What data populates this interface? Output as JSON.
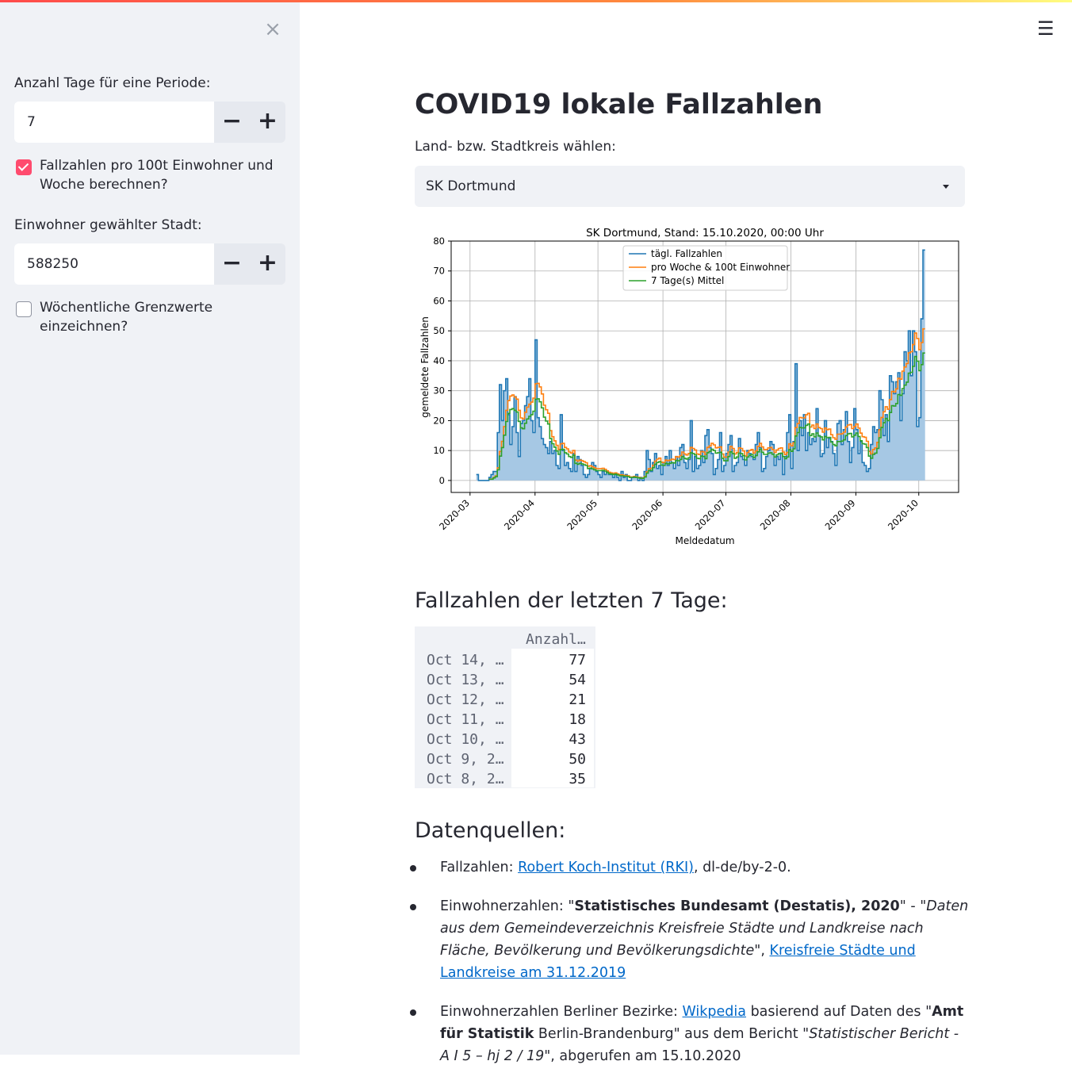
{
  "sidebar": {
    "period_label": "Anzahl Tage für eine Periode:",
    "period_value": "7",
    "minus": "−",
    "plus": "+",
    "per100k_label": "Fallzahlen pro 100t Einwohner und Woche berechnen?",
    "per100k_checked": true,
    "population_label": "Einwohner gewählter Stadt:",
    "population_value": "588250",
    "thresholds_label": "Wöchentliche Grenzwerte einzeichnen?",
    "thresholds_checked": false,
    "close_icon": "close-icon"
  },
  "header": {
    "menu_icon": "hamburger-menu-icon"
  },
  "main": {
    "title": "COVID19 lokale Fallzahlen",
    "select_label": "Land- bzw. Stadtkreis wählen:",
    "select_value": "SK Dortmund",
    "table_title": "Fallzahlen der letzten 7 Tage:",
    "table": {
      "column": "Anzahl…",
      "rows": [
        {
          "index": "Oct 14, …",
          "value": "77"
        },
        {
          "index": "Oct 13, …",
          "value": "54"
        },
        {
          "index": "Oct 12, …",
          "value": "21"
        },
        {
          "index": "Oct 11, …",
          "value": "18"
        },
        {
          "index": "Oct 10, …",
          "value": "43"
        },
        {
          "index": "Oct 9, 2…",
          "value": "50"
        },
        {
          "index": "Oct 8, 2…",
          "value": "35"
        }
      ]
    },
    "sources_title": "Datenquellen:",
    "sources": {
      "s1_prefix": "Fallzahlen: ",
      "s1_link": "Robert Koch-Institut (RKI)",
      "s1_suffix": ", dl-de/by-2-0.",
      "s2_prefix": "Einwohnerzahlen: \"",
      "s2_bold": "Statistisches Bundesamt (Destatis), 2020",
      "s2_mid": "\" - \"",
      "s2_italic": "Daten aus dem Gemeindeverzeichnis Kreisfreie Städte und Landkreise nach Fläche, Bevölkerung und Bevölkerungsdichte",
      "s2_after": "\", ",
      "s2_link": "Kreisfreie Städte und Landkreise am 31.12.2019",
      "s3_prefix": "Einwohnerzahlen Berliner Bezirke: ",
      "s3_link": "Wikpedia",
      "s3_mid": " basierend auf Daten des \"",
      "s3_bold1": "Amt für Statistik",
      "s3_mid2": " Berlin-Brandenburg\" aus dem Bericht \"",
      "s3_italic": "Statistischer Bericht - A I 5 – hj 2 / 19",
      "s3_suffix": "\", abgerufen am 15.10.2020"
    }
  },
  "chart_data": {
    "type": "line",
    "title": "SK Dortmund, Stand: 15.10.2020, 00:00 Uhr",
    "xlabel": "Meldedatum",
    "ylabel": "gemeldete Fallzahlen",
    "x_tick_labels": [
      "2020-03",
      "2020-04",
      "2020-05",
      "2020-06",
      "2020-07",
      "2020-08",
      "2020-09",
      "2020-10"
    ],
    "y_ticks": [
      0,
      10,
      20,
      30,
      40,
      50,
      60,
      70,
      80
    ],
    "ylim": [
      -4,
      80
    ],
    "xlim": [
      "2020-02-21",
      "2020-10-20"
    ],
    "grid": true,
    "legend_position": "top-center",
    "x_start": "2020-03-04",
    "series": [
      {
        "name": "tägl. Fallzahlen",
        "color": "#1f77b4",
        "fill": "#a6c8e4",
        "values": [
          2,
          0,
          0,
          0,
          0,
          0,
          1,
          2,
          3,
          3,
          16,
          32,
          20,
          30,
          34,
          22,
          12,
          18,
          28,
          16,
          8,
          19,
          20,
          25,
          28,
          34,
          20,
          16,
          47,
          21,
          18,
          14,
          12,
          11,
          9,
          13,
          9,
          10,
          5,
          4,
          22,
          10,
          5,
          6,
          4,
          3,
          9,
          3,
          8,
          7,
          5,
          2,
          1,
          2,
          4,
          6,
          5,
          3,
          2,
          1,
          3,
          2,
          3,
          2,
          2,
          1,
          2,
          1,
          0,
          3,
          1,
          2,
          0,
          0,
          1,
          1,
          2,
          0,
          1,
          0,
          3,
          10,
          7,
          3,
          6,
          9,
          4,
          5,
          2,
          6,
          8,
          5,
          10,
          6,
          4,
          8,
          5,
          11,
          12,
          6,
          4,
          7,
          20,
          3,
          8,
          4,
          5,
          10,
          6,
          15,
          17,
          11,
          9,
          2,
          4,
          7,
          16,
          3,
          5,
          9,
          12,
          15,
          3,
          5,
          6,
          14,
          8,
          7,
          5,
          10,
          9,
          8,
          7,
          12,
          16,
          11,
          3,
          4,
          8,
          10,
          13,
          12,
          5,
          8,
          7,
          9,
          2,
          8,
          16,
          22,
          4,
          13,
          39,
          10,
          20,
          15,
          22,
          10,
          16,
          12,
          14,
          13,
          24,
          15,
          8,
          9,
          20,
          11,
          14,
          13,
          9,
          5,
          19,
          20,
          12,
          17,
          23,
          13,
          6,
          11,
          24,
          17,
          9,
          13,
          6,
          5,
          3,
          4,
          12,
          18,
          16,
          17,
          30,
          27,
          15,
          22,
          13,
          35,
          33,
          29,
          33,
          36,
          20,
          29,
          43,
          40,
          50,
          35,
          50,
          43,
          18,
          21,
          54,
          77
        ]
      },
      {
        "name": "pro Woche & 100t Einwohner",
        "color": "#ff7f0e",
        "values": []
      },
      {
        "name": "7 Tage(s) Mittel",
        "color": "#2ca02c",
        "values": []
      }
    ]
  }
}
